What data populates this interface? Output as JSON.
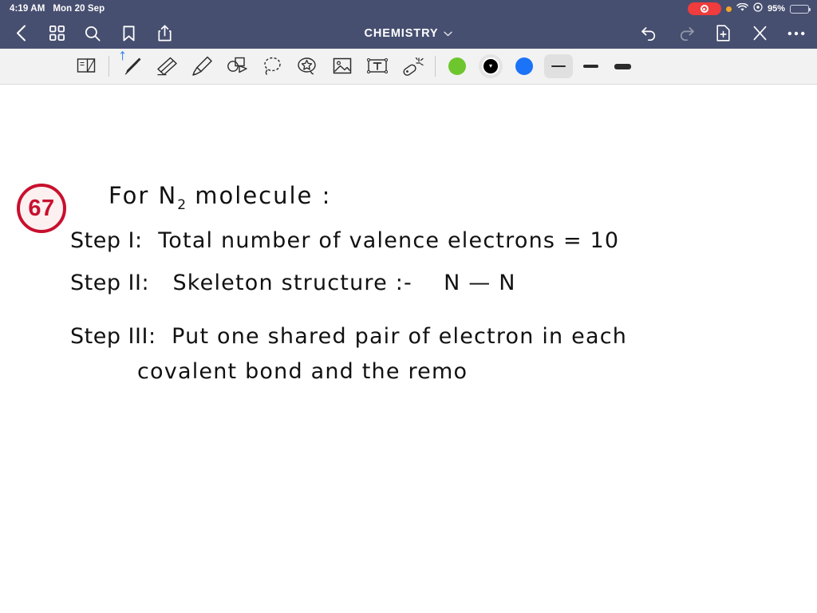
{
  "status_bar": {
    "time": "4:19 AM",
    "date": "Mon 20 Sep",
    "recording_icon": "record-indicator",
    "orange_dot_icon": "microphone-in-use-dot",
    "wifi_icon": "wifi-icon",
    "focus_icon": "do-not-disturb-icon",
    "battery_percent": "95%",
    "battery_icon": "battery-icon",
    "background_color": "#474f70"
  },
  "nav_bar": {
    "title": "CHEMISTRY",
    "title_chevron": "⌄",
    "left_icons": [
      {
        "name": "back-button",
        "glyph": "chevron-left-icon"
      },
      {
        "name": "pages-grid-button",
        "glyph": "grid-icon"
      },
      {
        "name": "search-button",
        "glyph": "search-icon"
      },
      {
        "name": "bookmark-button",
        "glyph": "bookmark-icon"
      },
      {
        "name": "share-button",
        "glyph": "share-icon"
      }
    ],
    "right_icons": [
      {
        "name": "undo-button",
        "glyph": "undo-icon",
        "enabled": "true"
      },
      {
        "name": "redo-button",
        "glyph": "redo-icon",
        "enabled": "false"
      },
      {
        "name": "add-page-button",
        "glyph": "document-plus-icon"
      },
      {
        "name": "close-button",
        "glyph": "close-x-icon"
      },
      {
        "name": "more-options-button",
        "glyph": "ellipsis-icon"
      }
    ]
  },
  "toolbar": {
    "background_color": "#f2f2f2",
    "tools": [
      {
        "name": "page-flip-tool",
        "label": "page-flip-icon",
        "selected": "false"
      },
      {
        "name": "pen-tool",
        "label": "pen-icon",
        "selected": "true",
        "badge": "bluetooth-icon"
      },
      {
        "name": "eraser-tool",
        "label": "eraser-icon",
        "selected": "false"
      },
      {
        "name": "highlighter-tool",
        "label": "highlighter-icon",
        "selected": "false"
      },
      {
        "name": "shapes-tool",
        "label": "shapes-icon",
        "selected": "false"
      },
      {
        "name": "lasso-tool",
        "label": "lasso-icon",
        "selected": "false"
      },
      {
        "name": "sticker-tool",
        "label": "sticker-star-icon",
        "selected": "false"
      },
      {
        "name": "image-tool",
        "label": "image-icon",
        "selected": "false"
      },
      {
        "name": "text-box-tool",
        "label": "text-box-icon",
        "selected": "false"
      },
      {
        "name": "magic-wand-tool",
        "label": "magic-wand-icon",
        "selected": "false"
      }
    ],
    "colors": [
      {
        "name": "color-swatch-green",
        "hex": "#6ec62e",
        "selected": "false"
      },
      {
        "name": "color-swatch-black",
        "hex": "#000000",
        "selected": "true"
      },
      {
        "name": "color-swatch-blue",
        "hex": "#1b73f8",
        "selected": "false"
      }
    ],
    "stroke_widths": [
      {
        "name": "stroke-width-thin",
        "selected": "true"
      },
      {
        "name": "stroke-width-medium",
        "selected": "false"
      },
      {
        "name": "stroke-width-thick",
        "selected": "false"
      }
    ]
  },
  "note": {
    "badge_number": "67",
    "badge_color": "#c8102e",
    "title_prefix": "For N",
    "title_subscript": "2",
    "title_suffix": " molecule :",
    "lines": [
      {
        "label": "Step I:",
        "text": "Total number of valence electrons = 10"
      },
      {
        "label": "Step II:",
        "text": "Skeleton structure :-",
        "extra": "N — N"
      },
      {
        "label": "Step III:",
        "text": "Put one shared pair of electron in each"
      },
      {
        "label": "",
        "text": "covalent bond and the remo"
      }
    ]
  }
}
